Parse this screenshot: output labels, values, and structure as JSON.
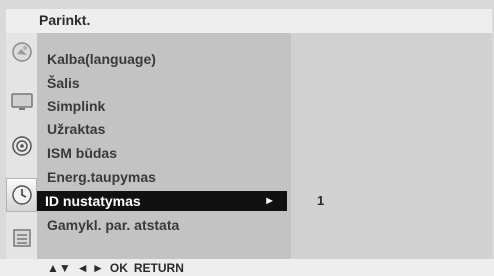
{
  "title": "Parinkt.",
  "icons": [
    "picture-icon",
    "tv-screen-icon",
    "audio-disc-icon",
    "clock-icon",
    "option-settings-icon"
  ],
  "menu": {
    "items": [
      {
        "label": "Kalba(language)"
      },
      {
        "label": "Šalis"
      },
      {
        "label": "Simplink"
      },
      {
        "label": "Užraktas"
      },
      {
        "label": "ISM būdas"
      },
      {
        "label": "Energ.taupymas"
      },
      {
        "label": "ID nustatymas",
        "arrow": "►"
      },
      {
        "label": "Gamykl. par. atstata"
      }
    ],
    "selected_index": 6
  },
  "value_panel": {
    "value": "1"
  },
  "footer": {
    "updown": "▲▼",
    "leftright": "◄ ►",
    "ok": "OK",
    "return": "RETURN"
  },
  "colors": {
    "selected_bg": "#111111",
    "selected_fg": "#ffffff",
    "menu_bg": "#c3c3c3",
    "value_bg": "#d1d1d1",
    "bar_bg": "#eeeeee"
  }
}
